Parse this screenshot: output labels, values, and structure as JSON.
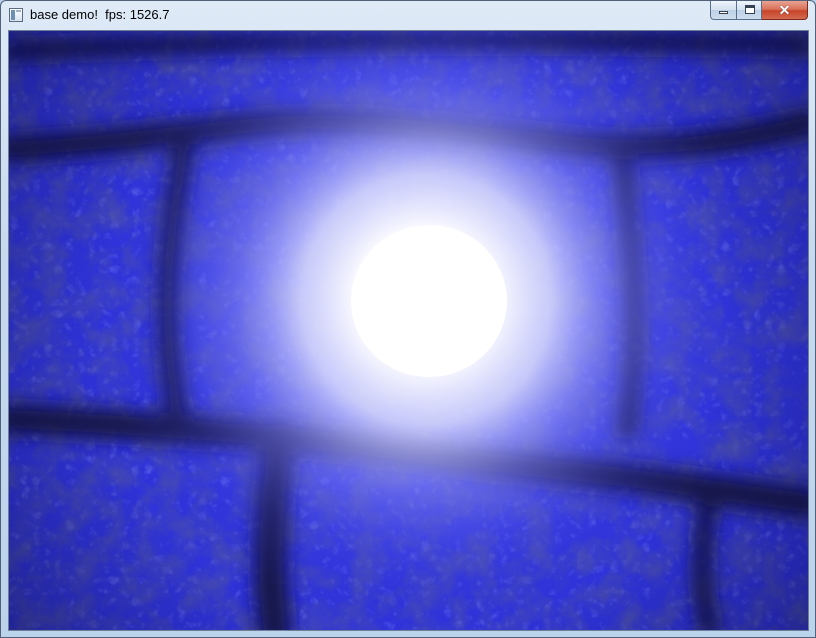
{
  "window": {
    "title": "base demo!  fps: 1526.7",
    "icons": {
      "app": "application-icon",
      "minimize": "minimize-icon",
      "maximize": "maximize-icon",
      "close": "close-icon"
    },
    "close_glyph": "✕"
  },
  "scene": {
    "description_kind": "rendered-3d-viewport",
    "base_color": "#2f33d9",
    "dark_color": "#15154f",
    "light_color": "#ffffff"
  }
}
